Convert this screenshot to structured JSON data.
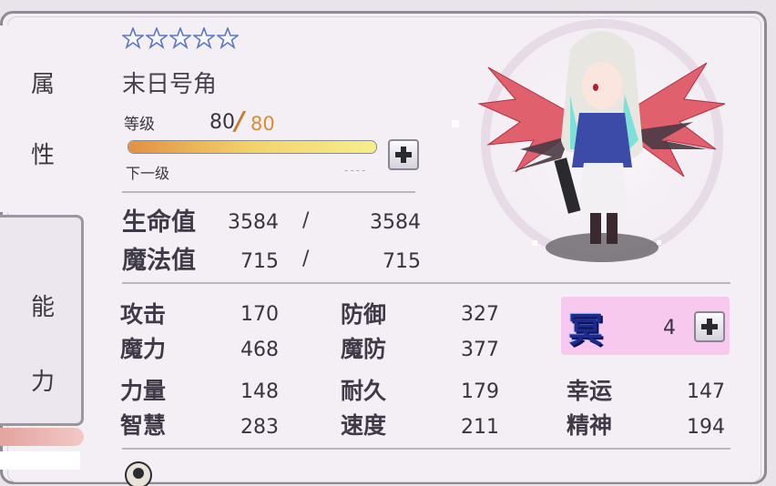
{
  "tabs": {
    "attributes": [
      "属",
      "性"
    ],
    "ability": [
      "能",
      "力"
    ]
  },
  "rarity_stars": 5,
  "character_name": "末日号角",
  "level": {
    "label": "等级",
    "current": "80",
    "max": "80",
    "next_label": "下一级",
    "next_value": "----"
  },
  "hp": {
    "label": "生命值",
    "current": "3584",
    "max": "3584"
  },
  "mp": {
    "label": "魔法值",
    "current": "715",
    "max": "715"
  },
  "stats": {
    "attack": {
      "label": "攻击",
      "value": "170"
    },
    "defense": {
      "label": "防御",
      "value": "327"
    },
    "magic": {
      "label": "魔力",
      "value": "468"
    },
    "magic_defense": {
      "label": "魔防",
      "value": "377"
    },
    "strength": {
      "label": "力量",
      "value": "148"
    },
    "endurance": {
      "label": "耐久",
      "value": "179"
    },
    "luck": {
      "label": "幸运",
      "value": "147"
    },
    "wisdom": {
      "label": "智慧",
      "value": "283"
    },
    "speed": {
      "label": "速度",
      "value": "211"
    },
    "spirit": {
      "label": "精神",
      "value": "194"
    }
  },
  "element": {
    "glyph": "冥",
    "value": "4"
  },
  "slash": "/",
  "colors": {
    "accent": "#d98e35",
    "element_bg": "#f7c9ee",
    "element_glyph": "#1d2b8f"
  },
  "icons": [
    "star-icon",
    "plus-icon",
    "character-portrait"
  ]
}
